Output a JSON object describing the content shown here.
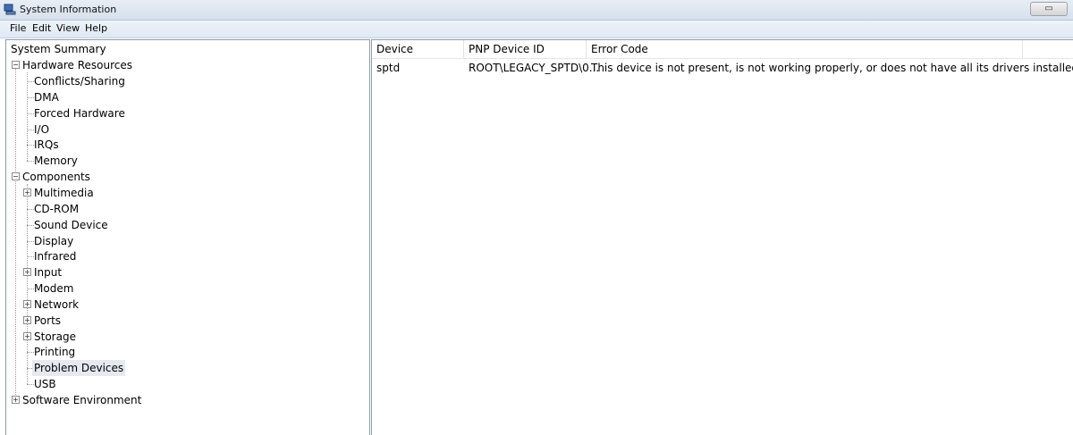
{
  "window": {
    "title": "System Information",
    "controls_label": "▭"
  },
  "menu": [
    "File",
    "Edit",
    "View",
    "Help"
  ],
  "tree": {
    "summary": "System Summary",
    "hardware": {
      "label": "Hardware Resources",
      "expander": "−",
      "items": [
        "Conflicts/Sharing",
        "DMA",
        "Forced Hardware",
        "I/O",
        "IRQs",
        "Memory"
      ]
    },
    "components": {
      "label": "Components",
      "expander": "−",
      "items": [
        {
          "label": "Multimedia",
          "expander": "+"
        },
        {
          "label": "CD-ROM"
        },
        {
          "label": "Sound Device"
        },
        {
          "label": "Display"
        },
        {
          "label": "Infrared"
        },
        {
          "label": "Input",
          "expander": "+"
        },
        {
          "label": "Modem"
        },
        {
          "label": "Network",
          "expander": "+"
        },
        {
          "label": "Ports",
          "expander": "+"
        },
        {
          "label": "Storage",
          "expander": "+"
        },
        {
          "label": "Printing"
        },
        {
          "label": "Problem Devices",
          "selected": true
        },
        {
          "label": "USB"
        }
      ]
    },
    "software": {
      "label": "Software Environment",
      "expander": "+"
    }
  },
  "table": {
    "columns": [
      "Device",
      "PNP Device ID",
      "Error Code"
    ],
    "rows": [
      [
        "sptd",
        "ROOT\\LEGACY_SPTD\\0...",
        "This device is not present, is not working properly, or does not have all its drivers installed."
      ]
    ]
  },
  "colors": {
    "selection": "#e5eaf0",
    "pane_border": "#8f9aa6",
    "titlebar": "#dfe7f1"
  }
}
